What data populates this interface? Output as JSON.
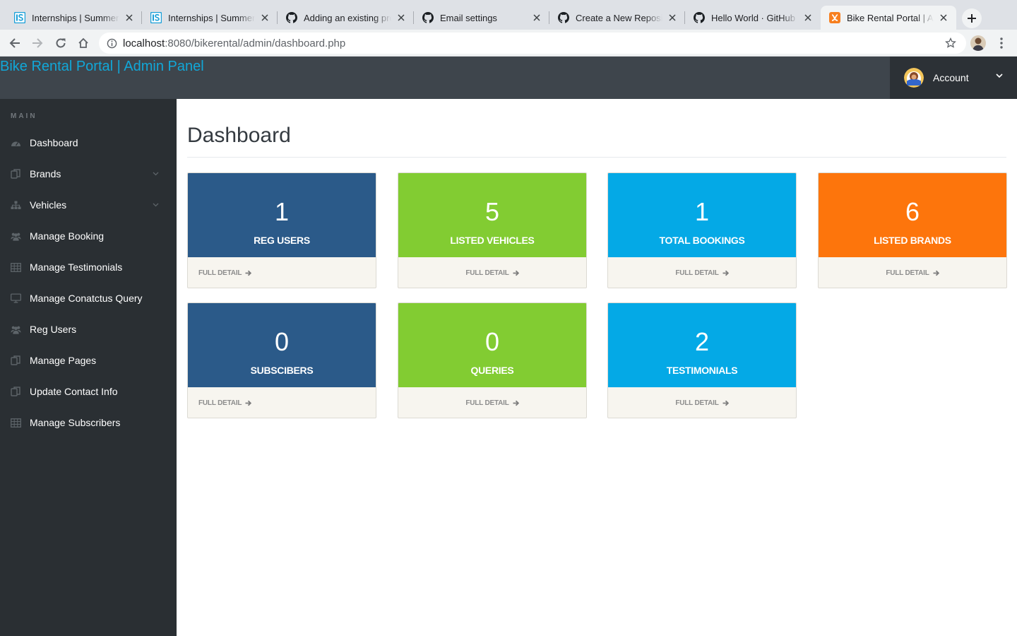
{
  "browser": {
    "tabs": [
      {
        "title": "Internships | Summer Internships",
        "favicon": "internshala-icon",
        "active": false
      },
      {
        "title": "Internships | Summer Internships",
        "favicon": "internshala-icon",
        "active": false
      },
      {
        "title": "Adding an existing project to GitHub",
        "favicon": "github-icon",
        "active": false
      },
      {
        "title": "Email settings",
        "favicon": "github-icon",
        "active": false
      },
      {
        "title": "Create a New Repository",
        "favicon": "github-icon",
        "active": false
      },
      {
        "title": "Hello World · GitHub Guides",
        "favicon": "github-icon",
        "active": false
      },
      {
        "title": "Bike Rental Portal | Admin Panel",
        "favicon": "xampp-icon",
        "active": true
      }
    ],
    "url_host": "localhost",
    "url_rest": ":8080/bikerental/admin/dashboard.php"
  },
  "header": {
    "brand": "Bike Rental Portal | Admin Panel",
    "account_label": "Account"
  },
  "sidebar": {
    "heading": "MAIN",
    "items": [
      {
        "label": "Dashboard",
        "icon": "dashboard-icon",
        "has_caret": false
      },
      {
        "label": "Brands",
        "icon": "files-icon",
        "has_caret": true
      },
      {
        "label": "Vehicles",
        "icon": "sitemap-icon",
        "has_caret": true
      },
      {
        "label": "Manage Booking",
        "icon": "users-icon",
        "has_caret": false
      },
      {
        "label": "Manage Testimonials",
        "icon": "table-icon",
        "has_caret": false
      },
      {
        "label": "Manage Conatctus Query",
        "icon": "desktop-icon",
        "has_caret": false
      },
      {
        "label": "Reg Users",
        "icon": "users-icon",
        "has_caret": false
      },
      {
        "label": "Manage Pages",
        "icon": "files-icon",
        "has_caret": false
      },
      {
        "label": "Update Contact Info",
        "icon": "files-icon",
        "has_caret": false
      },
      {
        "label": "Manage Subscribers",
        "icon": "table-icon",
        "has_caret": false
      }
    ]
  },
  "main": {
    "title": "Dashboard",
    "footer_link": "FULL DETAIL",
    "cards": [
      {
        "number": "1",
        "label": "REG USERS",
        "color": "#2b5a89",
        "foot_align": "left"
      },
      {
        "number": "5",
        "label": "LISTED VEHICLES",
        "color": "#82cc32",
        "foot_align": "center"
      },
      {
        "number": "1",
        "label": "TOTAL BOOKINGS",
        "color": "#04a9e6",
        "foot_align": "center"
      },
      {
        "number": "6",
        "label": "LISTED BRANDS",
        "color": "#fd750c",
        "foot_align": "center"
      },
      {
        "number": "0",
        "label": "SUBSCIBERS",
        "color": "#2b5a89",
        "foot_align": "left"
      },
      {
        "number": "0",
        "label": "QUERIES",
        "color": "#82cc32",
        "foot_align": "center"
      },
      {
        "number": "2",
        "label": "TESTIMONIALS",
        "color": "#04a9e6",
        "foot_align": "center"
      }
    ]
  }
}
